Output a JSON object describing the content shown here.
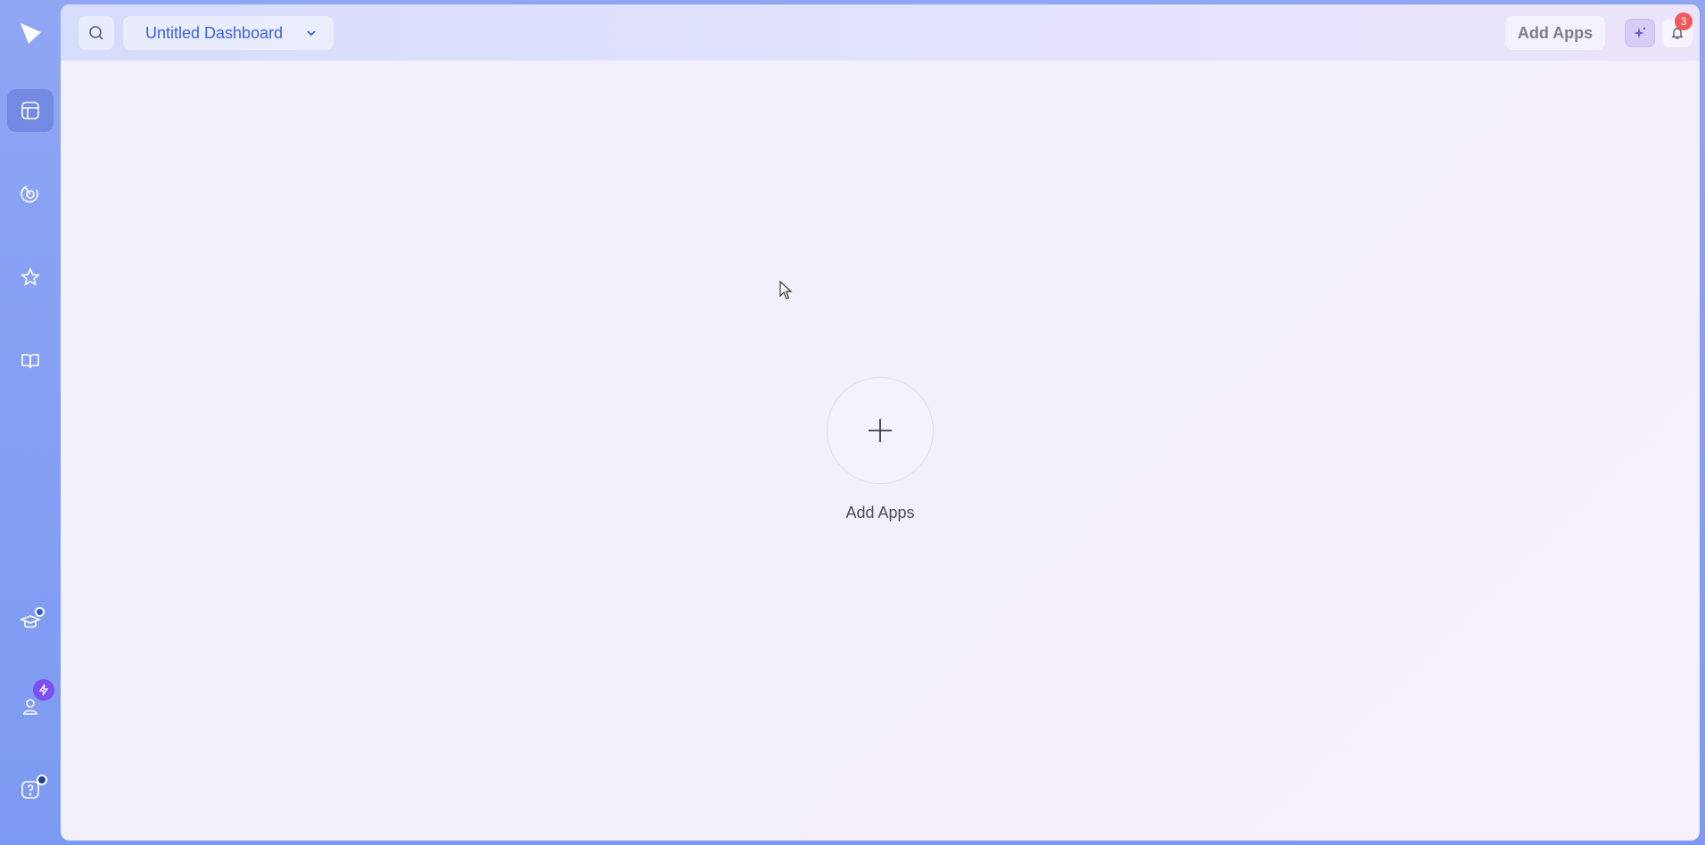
{
  "header": {
    "dashboard_name": "Untitled Dashboard",
    "add_apps_label": "Add Apps",
    "notification_count": "3"
  },
  "main": {
    "add_apps_label": "Add Apps"
  },
  "sidebar": {
    "items": [
      {
        "icon": "dashboard-icon",
        "active": true
      },
      {
        "icon": "radar-icon",
        "active": false
      },
      {
        "icon": "star-icon",
        "active": false
      },
      {
        "icon": "book-icon",
        "active": false
      },
      {
        "icon": "graduation-cap-icon",
        "active": false
      },
      {
        "icon": "user-icon",
        "active": false
      },
      {
        "icon": "help-icon",
        "active": false
      }
    ]
  },
  "colors": {
    "accent": "#3b63d9",
    "badge": "#f0595b",
    "sidebar_bg": "#86a0f4"
  }
}
